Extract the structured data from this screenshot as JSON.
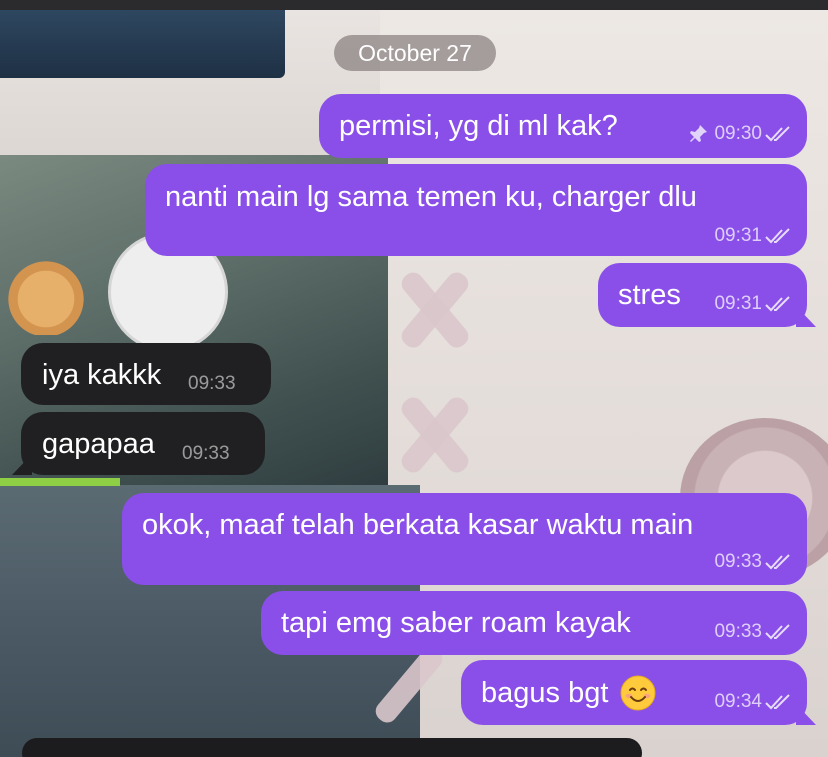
{
  "date_label": "October 27",
  "messages": [
    {
      "text": "permisi, yg di ml kak?",
      "time": "09:30",
      "direction": "out",
      "pinned": true,
      "status_icon": "double-check-icon"
    },
    {
      "text": "nanti main lg sama temen ku, charger dlu",
      "time": "09:31",
      "direction": "out",
      "status_icon": "double-check-icon"
    },
    {
      "text": "stres",
      "time": "09:31",
      "direction": "out",
      "status_icon": "double-check-icon"
    },
    {
      "text": "iya kakkk",
      "time": "09:33",
      "direction": "in"
    },
    {
      "text": "gapapaa",
      "time": "09:33",
      "direction": "in"
    },
    {
      "text": "okok, maaf telah berkata kasar waktu main",
      "time": "09:33",
      "direction": "out",
      "status_icon": "double-check-icon"
    },
    {
      "text": "tapi emg saber roam kayak",
      "time": "09:33",
      "direction": "out",
      "status_icon": "double-check-icon"
    },
    {
      "text": "bagus bgt",
      "emoji": "smiling-face-emoji",
      "time": "09:34",
      "direction": "out",
      "status_icon": "double-check-icon"
    }
  ],
  "colors": {
    "outgoing_bubble": "#8a4fe8",
    "incoming_bubble": "#202022",
    "date_pill": "#787070"
  }
}
